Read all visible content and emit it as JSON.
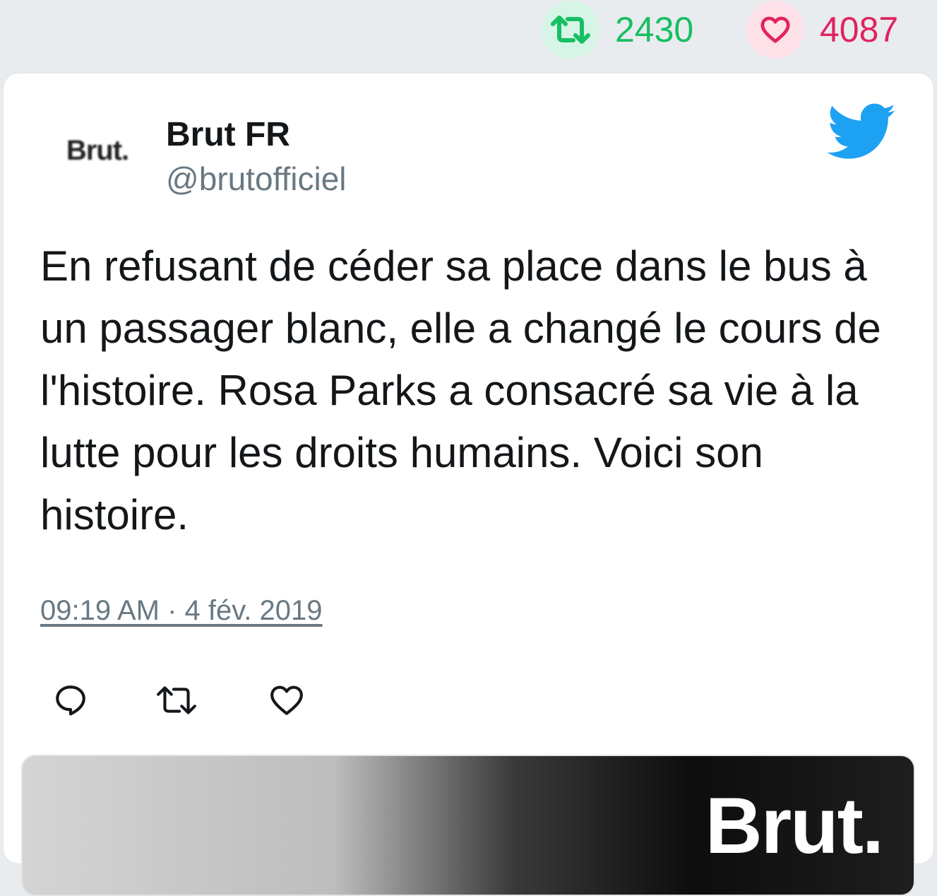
{
  "stats": {
    "retweets": "2430",
    "likes": "4087"
  },
  "colors": {
    "retweet": "#17bf63",
    "like": "#e0245e",
    "bird": "#1da1f2",
    "muted": "#697882"
  },
  "tweet": {
    "avatar_text": "Brut.",
    "name": "Brut FR",
    "handle": "@brutofficiel",
    "text": "En refusant de céder sa place dans le bus à un passager blanc, elle a changé le cours de l'histoire. Rosa Parks a consacré sa vie à la lutte pour les droits humains. Voici son histoire.",
    "timestamp": "09:19 AM · 4 fév. 2019"
  },
  "icons": {
    "stats": [
      "retweet-icon",
      "heart-icon"
    ],
    "header": "twitter-bird-icon",
    "actions": [
      "reply-icon",
      "retweet-icon",
      "like-icon"
    ]
  },
  "media": {
    "logo_text": "Brut."
  }
}
